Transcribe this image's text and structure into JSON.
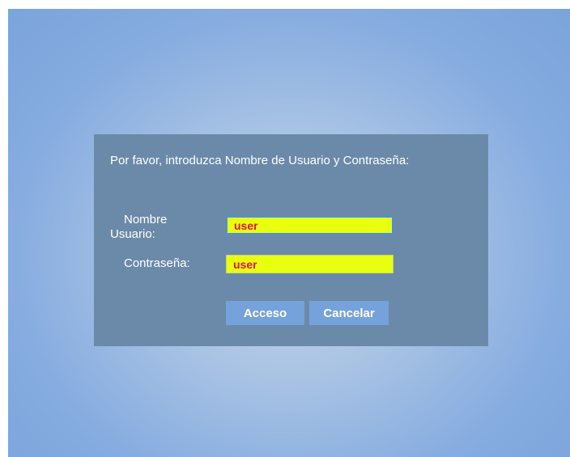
{
  "login": {
    "prompt": "Por favor, introduzca Nombre de Usuario y Contraseña:",
    "username_label_line1": "Nombre",
    "username_label_line2": "Usuario:",
    "password_label": "Contraseña:",
    "username_value": "user",
    "password_value": "user",
    "submit_label": "Acceso",
    "cancel_label": "Cancelar"
  },
  "colors": {
    "background": "#86ace0",
    "dialog": "#6b8aa9",
    "field_bg": "#e8ff10",
    "field_text": "#e8104a",
    "button": "#75a2db"
  }
}
